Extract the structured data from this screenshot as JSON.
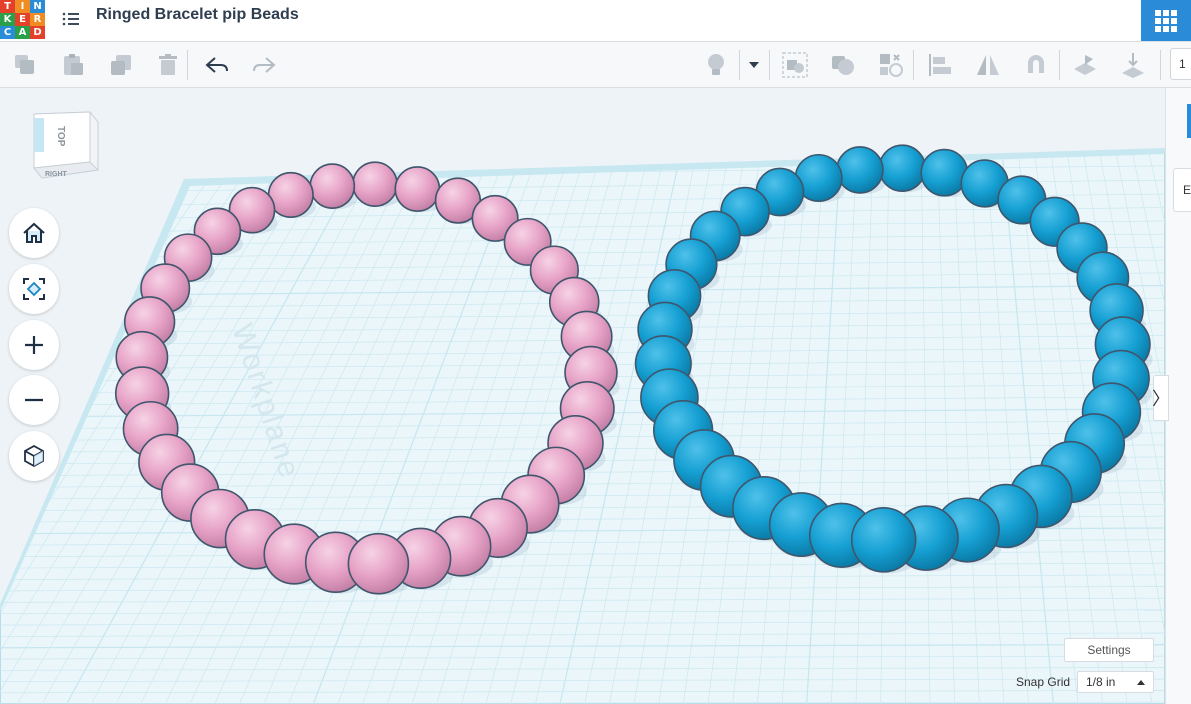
{
  "header": {
    "logo_letters": [
      "T",
      "I",
      "N",
      "K",
      "E",
      "R",
      "C",
      "A",
      "D"
    ],
    "logo_colors": [
      "#e4412b",
      "#f08c22",
      "#2a8bd8",
      "#2aa04a",
      "#e4412b",
      "#f08c22",
      "#2a8bd8",
      "#2aa04a",
      "#e4412b"
    ],
    "title": "Ringed Bracelet pip Beads",
    "menu_icon": "list-menu-icon",
    "apps_icon": "apps-grid-icon"
  },
  "toolbar": {
    "edit_icons": [
      "copy-icon",
      "paste-icon",
      "duplicate-icon",
      "delete-icon"
    ],
    "history_icons": [
      "undo-icon",
      "redo-icon"
    ],
    "view_icons": [
      "lightbulb-icon",
      "dropdown-caret-icon",
      "group-icon",
      "ungroup-icon",
      "hole-solid-icon",
      "align-icon",
      "mirror-icon",
      "magnet-icon",
      "workplane-icon",
      "ruler-icon"
    ],
    "edge_value": "1"
  },
  "viewcube": {
    "top_label": "TOP",
    "right_label": "RIGHT"
  },
  "nav": {
    "home_icon": "home-icon",
    "fit_icon": "fit-all-icon",
    "zoom_in_icon": "zoom-in-icon",
    "zoom_out_icon": "zoom-out-icon",
    "ortho_icon": "perspective-cube-icon"
  },
  "right_panel": {
    "tab_letter": "E",
    "toggle_glyph": "〉"
  },
  "bottom": {
    "settings_label": "Settings",
    "snap_label": "Snap Grid",
    "snap_value": "1/8 in"
  },
  "colors": {
    "pink_bead": "#e6a2c6",
    "blue_bead": "#1aa0d2",
    "grid_line": "#c7e6ef",
    "workplane": "#e9f7fb",
    "accent": "#2a8bd8"
  },
  "workplane_text": "Workplane",
  "scene": {
    "pink_bead_count": 33,
    "blue_bead_count": 34
  }
}
